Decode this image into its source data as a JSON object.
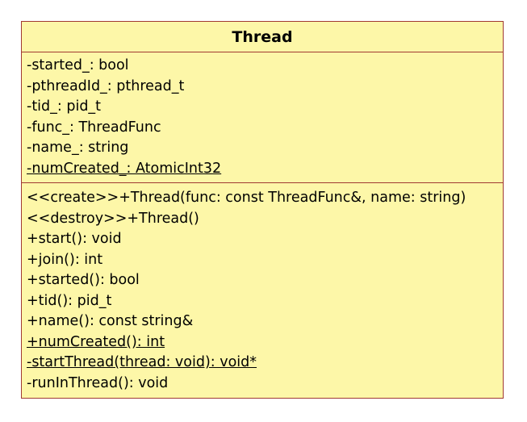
{
  "class": {
    "name": "Thread",
    "attributes": [
      {
        "text": "-started_: bool",
        "static": false
      },
      {
        "text": "-pthreadId_: pthread_t",
        "static": false
      },
      {
        "text": "-tid_: pid_t",
        "static": false
      },
      {
        "text": "-func_: ThreadFunc",
        "static": false
      },
      {
        "text": "-name_: string",
        "static": false
      },
      {
        "text": "-numCreated_: AtomicInt32",
        "static": true
      }
    ],
    "operations": [
      {
        "text": "<<create>>+Thread(func: const ThreadFunc&, name: string)",
        "static": false
      },
      {
        "text": "<<destroy>>+Thread()",
        "static": false
      },
      {
        "text": "+start(): void",
        "static": false
      },
      {
        "text": "+join(): int",
        "static": false
      },
      {
        "text": "+started(): bool",
        "static": false
      },
      {
        "text": "+tid(): pid_t",
        "static": false
      },
      {
        "text": "+name(): const string&",
        "static": false
      },
      {
        "text": "+numCreated(): int",
        "static": true
      },
      {
        "text": "-startThread(thread: void): void*",
        "static": true
      },
      {
        "text": "-runInThread(): void",
        "static": false
      }
    ]
  },
  "colors": {
    "fill": "#fdf7a8",
    "border": "#a03a32",
    "text": "#000000"
  }
}
